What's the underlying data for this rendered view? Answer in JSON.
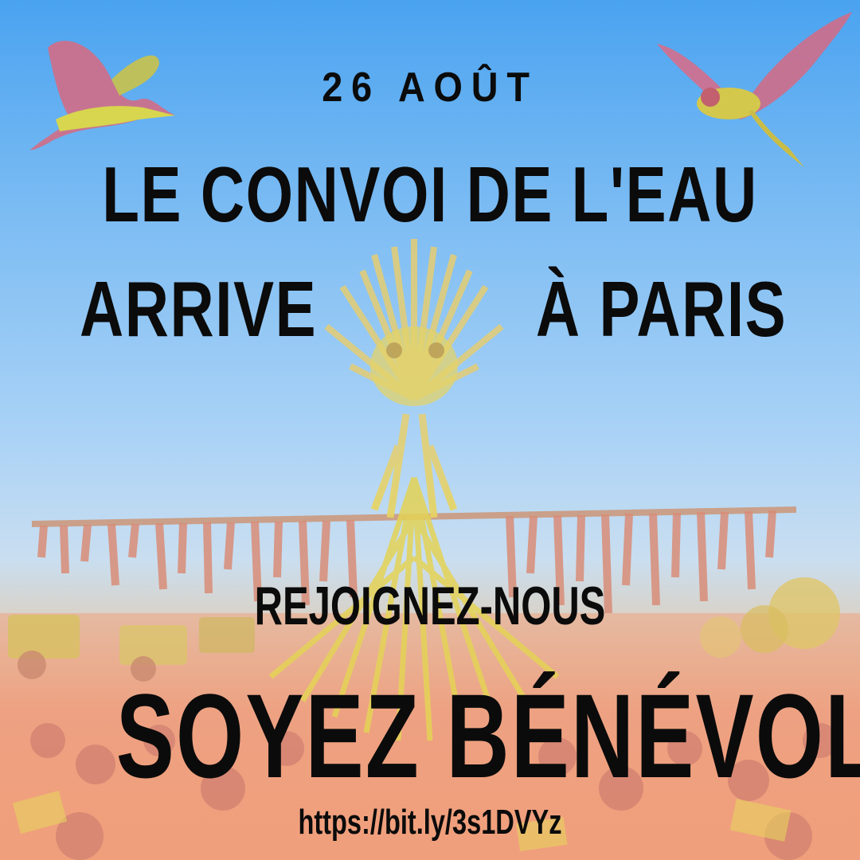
{
  "poster": {
    "date": "26 AOÛT",
    "title_line1": "LE CONVOI DE L'EAU",
    "title_line2_left": "ARRIVE",
    "title_line2_right": "À PARIS",
    "call_to_action": "REJOIGNEZ-NOUS",
    "headline": "SOYEZ BÉNÉVOLE !",
    "url": "https://bit.ly/3s1DVYz"
  },
  "colors": {
    "sky_top": "#4aa3f0",
    "sky_mid": "#a9d2f6",
    "warm_bottom": "#ef9a7a",
    "figure_yellow": "#e6d96a",
    "bird_pink": "#d46a8a",
    "text": "#0b0b0b"
  },
  "images": [
    "heron-bird-icon",
    "swallow-bird-icon",
    "straw-sculpture-figure",
    "crowd-and-tractors-scene"
  ]
}
